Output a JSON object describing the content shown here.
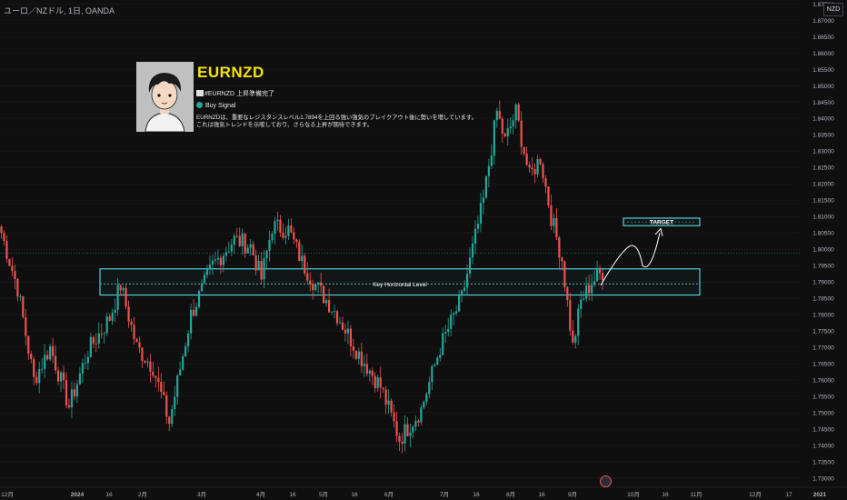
{
  "header": {
    "symbol_line": "ユーロ／NZドル, 1日, OANDA",
    "currency_button": "NZD"
  },
  "info_card": {
    "symbol": "EURNZD",
    "line1": "#EURNZD 上昇準備完了",
    "line2": "Buy Signal",
    "desc_line1": "EURNZDは、重要なレジスタンスレベル1.7894を上回る強い強気のブレイクアウト後に勢いを増しています。",
    "desc_line2": "これは強気トレンドを示唆しており、さらなる上昇が期待できます。"
  },
  "colors": {
    "up": "#26a69a",
    "down": "#ef5350",
    "box": "#4dd0e1",
    "accent_yellow": "#f5e400",
    "background": "#0f0f0f"
  },
  "chart_data": {
    "type": "candlestick",
    "title": "",
    "ylim": [
      1.7275,
      1.8762
    ],
    "y_ticks": [
      "1.87500",
      "1.87000",
      "1.86500",
      "1.86000",
      "1.85500",
      "1.85000",
      "1.84500",
      "1.84000",
      "1.83500",
      "1.83000",
      "1.82500",
      "1.82000",
      "1.81500",
      "1.81000",
      "1.80500",
      "1.80000",
      "1.79500",
      "1.79000",
      "1.78500",
      "1.78000",
      "1.77500",
      "1.77000",
      "1.76500",
      "1.76000",
      "1.75500",
      "1.75000",
      "1.74500",
      "1.74000",
      "1.73500",
      "1.73000"
    ],
    "x_ticks": [
      "12月",
      "2024",
      "16",
      "2月",
      "3月",
      "4月",
      "16",
      "5月",
      "16",
      "6月",
      "7月",
      "16",
      "8月",
      "16",
      "9月",
      "10月",
      "16",
      "11月",
      "12月",
      "17",
      "2021"
    ],
    "last_price": {
      "symbol": "EURNZD",
      "value": "1.79873",
      "y": 1.79873
    },
    "key_level": {
      "label": "Key Horizontal Level",
      "value": 1.7894,
      "top": 1.794,
      "bottom": 1.786
    },
    "target": {
      "label": "TARGET",
      "top": 1.8095,
      "bottom": 1.8072
    },
    "waypoints": [
      {
        "b": 0,
        "p": 1.805
      },
      {
        "b": 6,
        "p": 1.788
      },
      {
        "b": 12,
        "p": 1.76
      },
      {
        "b": 18,
        "p": 1.77
      },
      {
        "b": 25,
        "p": 1.752
      },
      {
        "b": 32,
        "p": 1.769
      },
      {
        "b": 40,
        "p": 1.779
      },
      {
        "b": 44,
        "p": 1.789
      },
      {
        "b": 50,
        "p": 1.77
      },
      {
        "b": 56,
        "p": 1.764
      },
      {
        "b": 62,
        "p": 1.747
      },
      {
        "b": 70,
        "p": 1.78
      },
      {
        "b": 78,
        "p": 1.795
      },
      {
        "b": 86,
        "p": 1.803
      },
      {
        "b": 92,
        "p": 1.801
      },
      {
        "b": 96,
        "p": 1.791
      },
      {
        "b": 100,
        "p": 1.807
      },
      {
        "b": 106,
        "p": 1.806
      },
      {
        "b": 111,
        "p": 1.796
      },
      {
        "b": 116,
        "p": 1.789
      },
      {
        "b": 124,
        "p": 1.78
      },
      {
        "b": 132,
        "p": 1.768
      },
      {
        "b": 140,
        "p": 1.758
      },
      {
        "b": 147,
        "p": 1.742
      },
      {
        "b": 155,
        "p": 1.751
      },
      {
        "b": 162,
        "p": 1.77
      },
      {
        "b": 170,
        "p": 1.785
      },
      {
        "b": 178,
        "p": 1.815
      },
      {
        "b": 183,
        "p": 1.842
      },
      {
        "b": 186,
        "p": 1.833
      },
      {
        "b": 190,
        "p": 1.842
      },
      {
        "b": 195,
        "p": 1.822
      },
      {
        "b": 199,
        "p": 1.828
      },
      {
        "b": 203,
        "p": 1.81
      },
      {
        "b": 207,
        "p": 1.797
      },
      {
        "b": 211,
        "p": 1.77
      },
      {
        "b": 214,
        "p": 1.784
      },
      {
        "b": 218,
        "p": 1.79
      },
      {
        "b": 222,
        "p": 1.793
      }
    ]
  }
}
